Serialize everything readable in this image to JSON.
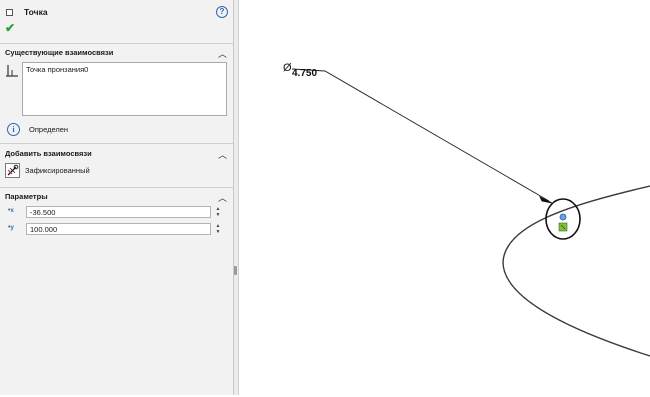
{
  "panel": {
    "title": "Точка",
    "existing_relations": {
      "header": "Существующие взаимосвязи",
      "items": [
        "Точка пронзания0"
      ]
    },
    "status": "Определен",
    "add_relations": {
      "header": "Добавить взаимосвязи",
      "fixed_label": "Зафиксированный"
    },
    "parameters": {
      "header": "Параметры",
      "x_value": "-36.500",
      "y_value": "100.000"
    }
  },
  "canvas": {
    "dimension_symbol": "Ø",
    "dimension_value": "4.750"
  },
  "colors": {
    "accent_blue": "#2f66b3",
    "check_green": "#2da02d",
    "point_blue": "#5fa8e0",
    "relation_marker": "#7fbf3f"
  }
}
